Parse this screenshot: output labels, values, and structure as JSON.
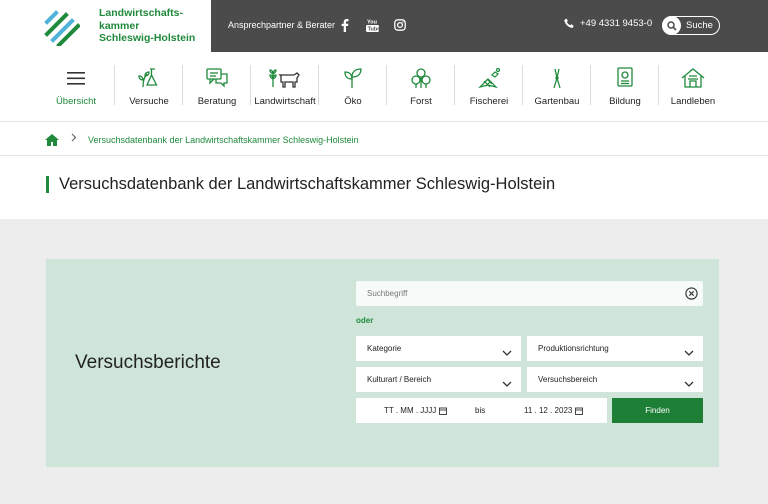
{
  "logo": {
    "line1": "Landwirtschafts-",
    "line2": "kammer",
    "line3": "Schleswig-Holstein"
  },
  "topbar": {
    "contact_label": "Ansprechpartner & Berater",
    "social": [
      "facebook-icon",
      "youtube-icon",
      "instagram-icon"
    ],
    "phone": "+49 4331 9453-0",
    "search_label": "Suche"
  },
  "nav": {
    "items": [
      {
        "label": "Übersicht",
        "icon": "menu-icon",
        "active": true
      },
      {
        "label": "Versuche",
        "icon": "flask-plant-icon"
      },
      {
        "label": "Beratung",
        "icon": "chat-icon"
      },
      {
        "label": "Landwirtschaft",
        "icon": "grain-cow-icon"
      },
      {
        "label": "Öko",
        "icon": "sprout-icon"
      },
      {
        "label": "Forst",
        "icon": "trees-icon"
      },
      {
        "label": "Fischerei",
        "icon": "fish-net-icon"
      },
      {
        "label": "Gartenbau",
        "icon": "shears-icon"
      },
      {
        "label": "Bildung",
        "icon": "certificate-icon"
      },
      {
        "label": "Landleben",
        "icon": "farmhouse-icon"
      }
    ]
  },
  "breadcrumb": {
    "current": "Versuchsdatenbank der Landwirtschaftskammer Schleswig-Holstein"
  },
  "page": {
    "title": "Versuchsdatenbank der Landwirtschaftskammer Schleswig-Holstein"
  },
  "search": {
    "heading": "Versuchsberichte",
    "placeholder": "Suchbegriff",
    "or_label": "oder",
    "kategorie": "Kategorie",
    "produktionsrichtung": "Produktionsrichtung",
    "kulturart": "Kulturart / Bereich",
    "versuchsbereich": "Versuchsbereich",
    "date_from": "TT . MM . JJJJ",
    "bis": "bis",
    "date_to": "11 . 12 . 2023",
    "submit": "Finden"
  },
  "colors": {
    "brand_green": "#1f8a3c",
    "panel_green": "#cfe5da",
    "topbar_dark": "#4b4b4b",
    "button_green": "#1d7f36"
  }
}
